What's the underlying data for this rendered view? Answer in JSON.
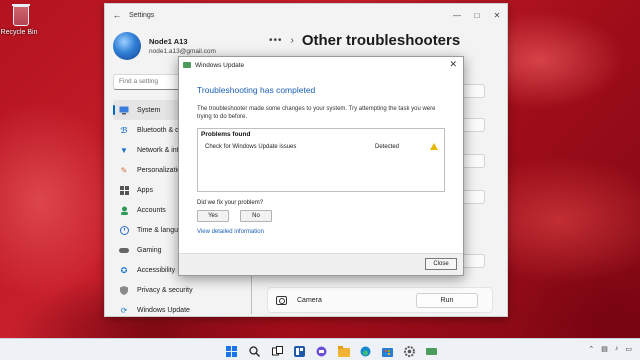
{
  "desktop": {
    "recycle_bin_label": "Recycle Bin"
  },
  "settings": {
    "title": "Settings",
    "profile": {
      "name": "Node1 A13",
      "email": "node1.a13@gmail.com"
    },
    "breadcrumb": {
      "dots": "•••",
      "page_title": "Other troubleshooters"
    },
    "search": {
      "placeholder": "Find a setting"
    },
    "nav": [
      {
        "label": "System",
        "icon": "monitor-icon",
        "active": true
      },
      {
        "label": "Bluetooth & de",
        "icon": "bluetooth-icon"
      },
      {
        "label": "Network & inte",
        "icon": "wifi-icon"
      },
      {
        "label": "Personalizatio",
        "icon": "brush-icon"
      },
      {
        "label": "Apps",
        "icon": "apps-icon"
      },
      {
        "label": "Accounts",
        "icon": "person-icon"
      },
      {
        "label": "Time & langua",
        "icon": "globe-clock-icon"
      },
      {
        "label": "Gaming",
        "icon": "gamepad-icon"
      },
      {
        "label": "Accessibility",
        "icon": "accessibility-icon"
      },
      {
        "label": "Privacy & security",
        "icon": "shield-icon"
      },
      {
        "label": "Windows Update",
        "icon": "sync-icon"
      }
    ],
    "camera_row": {
      "label": "Camera",
      "run_label": "Run"
    }
  },
  "dialog": {
    "window_title": "Windows Update",
    "heading": "Troubleshooting has completed",
    "description": "The troubleshooter made some changes to your system. Try attempting the task you were trying to do before.",
    "problems_header": "Problems found",
    "problems": [
      {
        "name": "Check for Windows Update issues",
        "status": "Detected",
        "icon": "warning-icon"
      }
    ],
    "fix_question": "Did we fix your problem?",
    "yes_label": "Yes",
    "no_label": "No",
    "detail_link": "View detailed information",
    "close_label": "Close"
  },
  "colors": {
    "accent": "#0067c0",
    "link": "#1a5fb4",
    "warning": "#e8b600"
  }
}
